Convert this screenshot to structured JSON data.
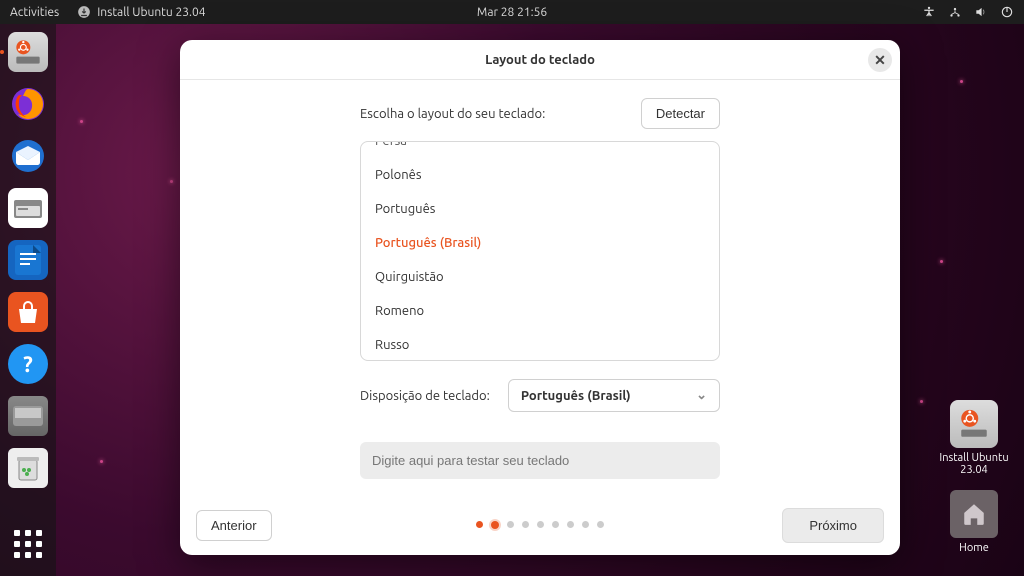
{
  "topbar": {
    "activities": "Activities",
    "app_title": "Install Ubuntu 23.04",
    "clock": "Mar 28  21:56"
  },
  "dock": {
    "items": [
      {
        "name": "install-ubuntu",
        "active": true
      },
      {
        "name": "firefox"
      },
      {
        "name": "thunderbird"
      },
      {
        "name": "files"
      },
      {
        "name": "libreoffice-writer"
      },
      {
        "name": "software-center"
      },
      {
        "name": "help"
      },
      {
        "name": "removable-volume"
      },
      {
        "name": "trash"
      }
    ]
  },
  "desktop": {
    "install_label": "Install Ubuntu 23.04",
    "home_label": "Home"
  },
  "installer": {
    "title": "Layout do teclado",
    "choose_label": "Escolha o layout do seu teclado:",
    "detect_button": "Detectar",
    "layouts": [
      "Persa",
      "Polonês",
      "Português",
      "Português (Brasil)",
      "Quirguistão",
      "Romeno",
      "Russo"
    ],
    "selected_index": 3,
    "disposition_label": "Disposição de teclado:",
    "disposition_value": "Português (Brasil)",
    "test_placeholder": "Digite aqui para testar seu teclado",
    "prev_button": "Anterior",
    "next_button": "Próximo",
    "step_total": 9,
    "step_current": 2
  },
  "colors": {
    "accent": "#e95420"
  }
}
